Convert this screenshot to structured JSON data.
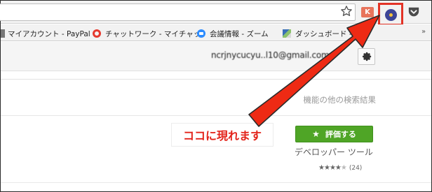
{
  "bookmarks": [
    {
      "label": "マイアカウント - PayPal",
      "icon": "paypal-icon"
    },
    {
      "label": "チャットワーク - マイチャッ",
      "icon": "chatwork-icon"
    },
    {
      "label": "会議情報 - ズーム",
      "icon": "zoom-icon"
    },
    {
      "label": "ダッシュボード - ",
      "icon": "dashboard-icon"
    }
  ],
  "bookmarks_more": "»",
  "extension_k_label": "K",
  "account": {
    "email": "ncrjnycucyu..l10@gmail.com"
  },
  "search_link": "機能の他の検索結果",
  "callout_text": "ココに現れます",
  "rate_button": {
    "label": "評価する",
    "icon": "star-icon"
  },
  "category": "デベロッパー ツール",
  "rating": {
    "stars": 3.5,
    "max": 5,
    "count": "(24)"
  },
  "colors": {
    "highlight": "#e33326",
    "arrow": "#ee2a14",
    "rate_button": "#4fa526",
    "callout_text": "#e3231a"
  }
}
